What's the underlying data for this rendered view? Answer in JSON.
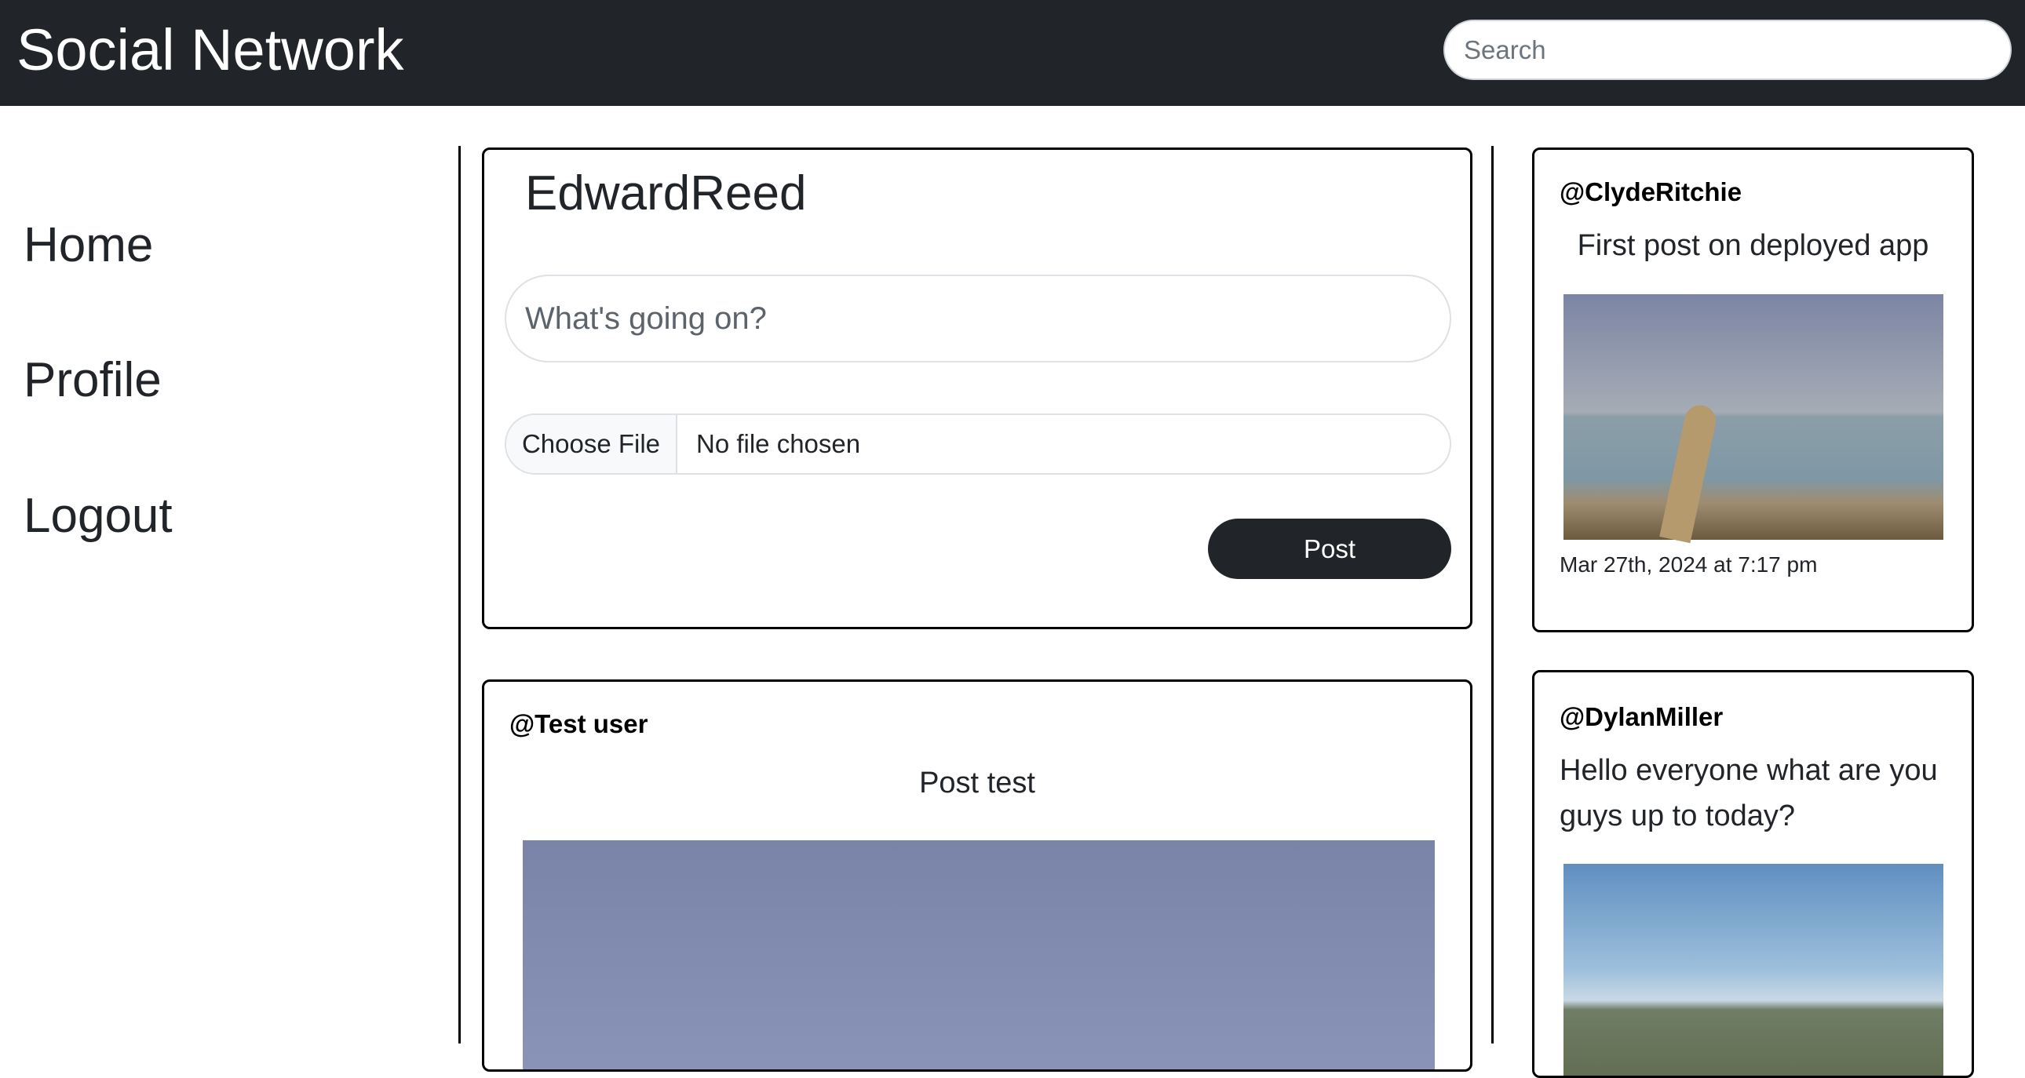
{
  "header": {
    "brand": "Social Network",
    "search_placeholder": "Search"
  },
  "nav": {
    "items": [
      {
        "label": "Home"
      },
      {
        "label": "Profile"
      },
      {
        "label": "Logout"
      }
    ]
  },
  "compose": {
    "username": "EdwardReed",
    "placeholder": "What's going on?",
    "file_button": "Choose File",
    "file_status": "No file chosen",
    "post_label": "Post"
  },
  "feed": [
    {
      "user": "@Test user",
      "text": "Post test"
    }
  ],
  "sidebar_posts": [
    {
      "user": "@ClydeRitchie",
      "text": "First post on deployed app",
      "date": "Mar 27th, 2024 at 7:17 pm"
    },
    {
      "user": "@DylanMiller",
      "text": "Hello everyone what are you guys up to today?"
    }
  ]
}
